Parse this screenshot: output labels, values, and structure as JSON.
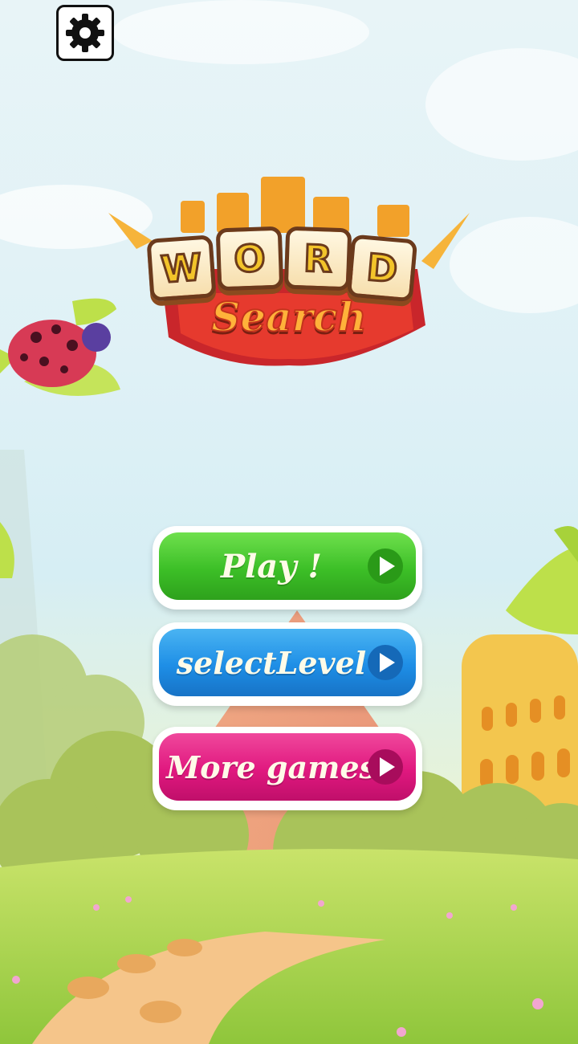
{
  "logo": {
    "letters": [
      "W",
      "O",
      "R",
      "D"
    ],
    "subtitle": "Search"
  },
  "settings": {
    "icon": "gear-icon"
  },
  "menu": {
    "play_label": "Play !",
    "select_level_label": "selectLevel",
    "more_games_label": "More games"
  },
  "colors": {
    "play": "#3fc42a",
    "select_level": "#1e8ee6",
    "more_games": "#e0187f"
  }
}
